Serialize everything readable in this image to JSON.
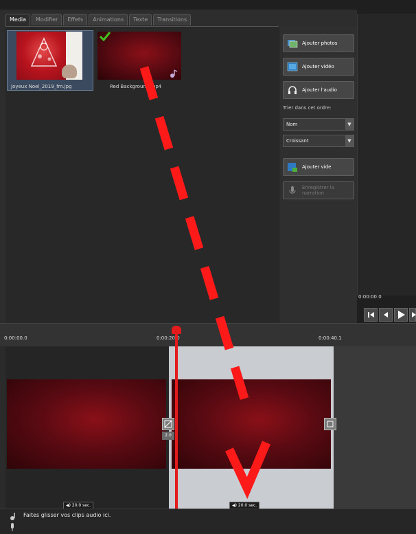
{
  "top_bar": {
    "labels": [
      "",
      "",
      "",
      "",
      "",
      ""
    ]
  },
  "tabs": [
    {
      "label": "Media",
      "active": true
    },
    {
      "label": "Modifier",
      "active": false
    },
    {
      "label": "Effets",
      "active": false
    },
    {
      "label": "Animations",
      "active": false
    },
    {
      "label": "Texte",
      "active": false
    },
    {
      "label": "Transitions",
      "active": false
    }
  ],
  "media": {
    "items": [
      {
        "caption": "Joyeux Noel_2019_fm.jpg",
        "type": "image",
        "selected": true
      },
      {
        "caption": "Red Background.mp4",
        "type": "video",
        "in_use": true
      }
    ]
  },
  "actions": {
    "add_photos": "Ajouter photos",
    "add_videos": "Ajouter vidéo",
    "add_audio": "Ajouter l'audio",
    "sort_label": "Trier dans cet ordre:",
    "sort_by": "Nom",
    "sort_order": "Croissant",
    "add_empty": "Ajouter vide",
    "dictate": "Enregistrer la narration"
  },
  "preview": {
    "time": "0:00:00.0"
  },
  "timeline": {
    "ruler": [
      "0:00:00.0",
      "0:00:20.0",
      "0:00:40.1"
    ],
    "clips": [
      {
        "duration": "20.0 sec."
      },
      {
        "duration": "20.0 sec."
      }
    ],
    "transition_duration": "2.0"
  },
  "audio_track": {
    "hint": "Faites glisser vos clips audio ici."
  },
  "annotation": {
    "color": "#ff1a1a"
  }
}
